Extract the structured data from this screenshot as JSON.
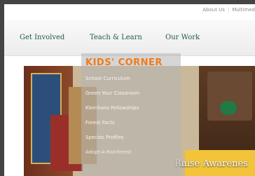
{
  "utility_links": {
    "about_us": "About Us",
    "separator": "|",
    "multimedia": "Multimed"
  },
  "nav": {
    "items": [
      "Get Involved",
      "Teach & Learn",
      "Our Work"
    ]
  },
  "dropdown": {
    "title": "KIDS' CORNER",
    "items": [
      "School Curriculum",
      "Green Your Classroom",
      "Kleinhans Fellowships",
      "Forest Facts",
      "Species Profiles",
      "Adopt-A-Rainforest"
    ]
  },
  "hero": {
    "caption": "Raise Awarenes"
  },
  "colors": {
    "nav_text": "#1f5a3b",
    "dropdown_title": "#f27a1a",
    "dropdown_bg": "#b4b4b4",
    "hero_yellow": "#f3c43a"
  }
}
